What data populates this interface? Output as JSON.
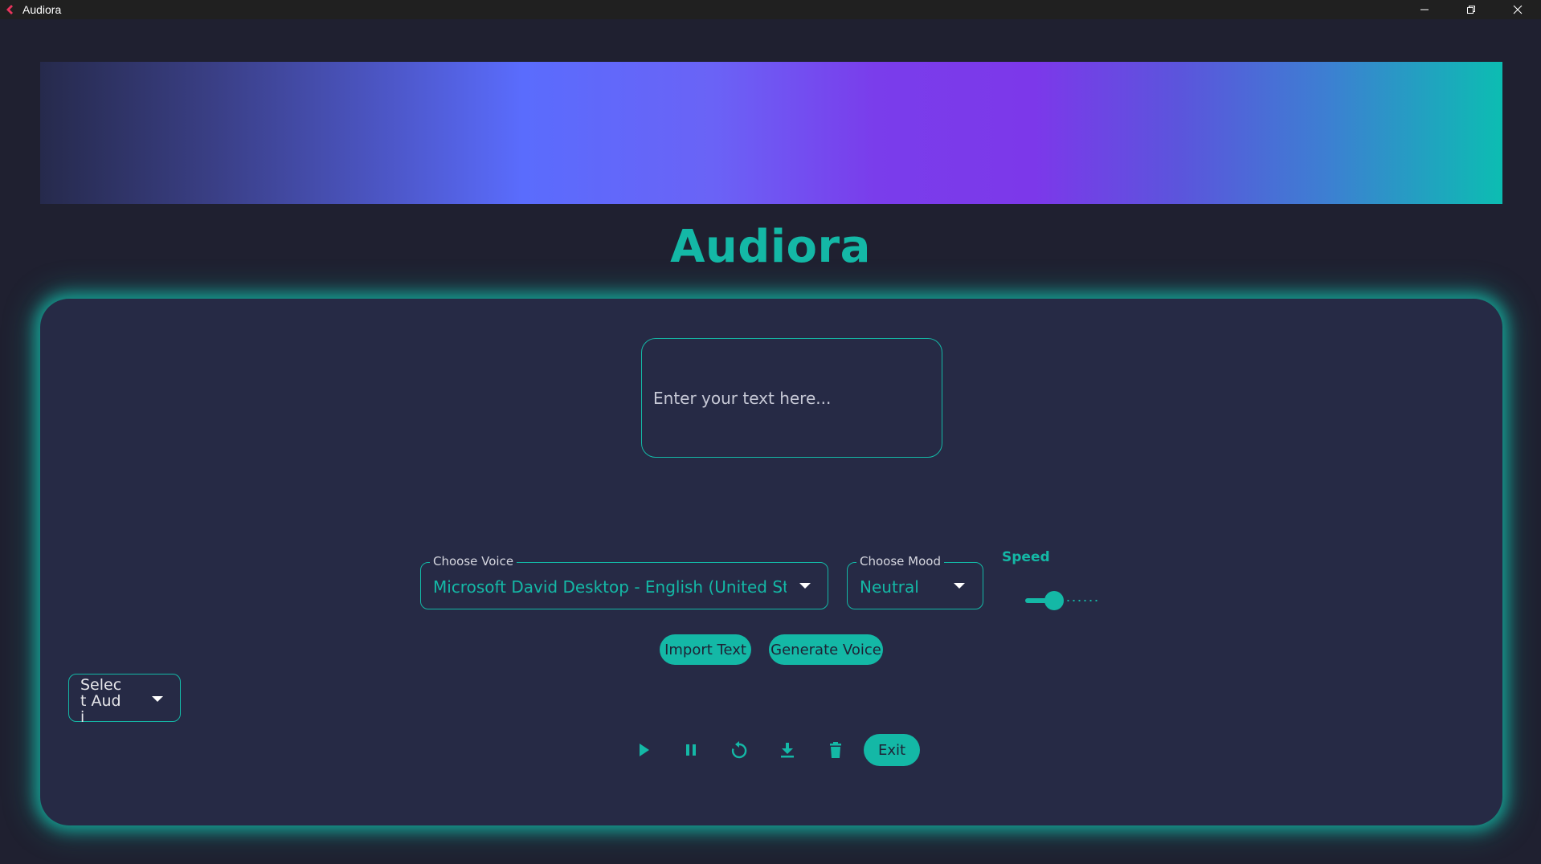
{
  "window": {
    "title": "Audiora",
    "controls": [
      "minimize-icon",
      "restore-icon",
      "close-icon"
    ]
  },
  "app": {
    "title": "Audiora",
    "accent": "#14b8a6"
  },
  "text_input": {
    "placeholder": "Enter your text here..."
  },
  "voice": {
    "label": "Choose Voice",
    "value": "Microsoft David Desktop - English (United Sta"
  },
  "mood": {
    "label": "Choose Mood",
    "value": "Neutral"
  },
  "speed": {
    "label": "Speed",
    "level": 0.25
  },
  "buttons": {
    "import_text": "Import Text",
    "generate_voice": "Generate Voice",
    "exit": "Exit"
  },
  "audio_select": {
    "value": "Select Audi"
  },
  "playback_icons": [
    "play-icon",
    "pause-icon",
    "replay-icon",
    "download-icon",
    "delete-icon"
  ]
}
